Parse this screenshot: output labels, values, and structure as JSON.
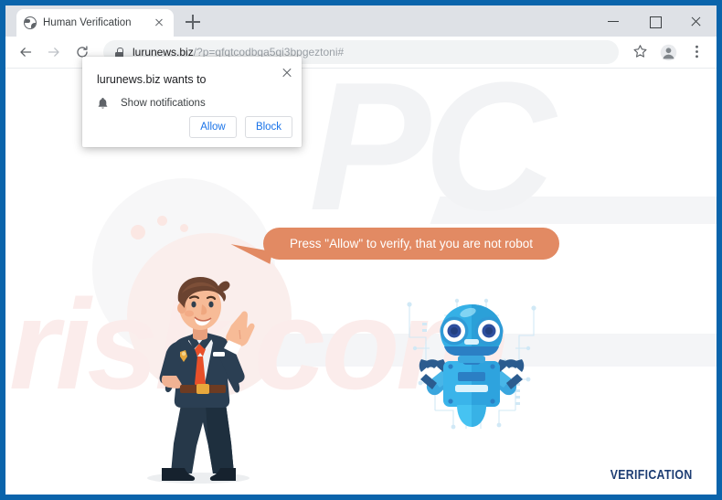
{
  "window": {
    "controls": {
      "minimize": "minimize-button",
      "maximize": "maximize-button",
      "close": "close-button"
    }
  },
  "tabstrip": {
    "tab": {
      "title": "Human Verification",
      "favicon": "globe-icon",
      "close_label": "close-tab"
    },
    "new_tab_label": "new-tab"
  },
  "toolbar": {
    "back_label": "Back",
    "forward_label": "Forward",
    "reload_label": "Reload",
    "omnibox": {
      "lock": "lock-icon",
      "domain": "lurunews.biz",
      "path": "/?p=gfqtcodbga5gi3bpgeztoni#"
    },
    "bookmark_label": "Bookmark this tab",
    "profile_label": "Profile",
    "menu_label": "Customize and control Google Chrome"
  },
  "notification_popup": {
    "title": "lurunews.biz wants to",
    "permission": "Show notifications",
    "permission_icon": "bell-icon",
    "allow_label": "Allow",
    "block_label": "Block",
    "close_label": "close-popup"
  },
  "page": {
    "bubble_text": "Press \"Allow\" to verify, that you are not robot",
    "verification_label": "VERIFICATION",
    "watermark": {
      "part1": "PC",
      "part2": "risk.com"
    },
    "man_illustration": "man-pointing-up-illustration",
    "robot_illustration": "robot-illustration"
  },
  "colors": {
    "frame_blue": "#0a64ab",
    "bubble_orange": "#e28a63",
    "link_blue": "#1a73e8",
    "verification_blue": "#1d3d73",
    "robot_cyan": "#2fc4f2",
    "suit_navy": "#263849",
    "tie_orange": "#e8502a"
  }
}
